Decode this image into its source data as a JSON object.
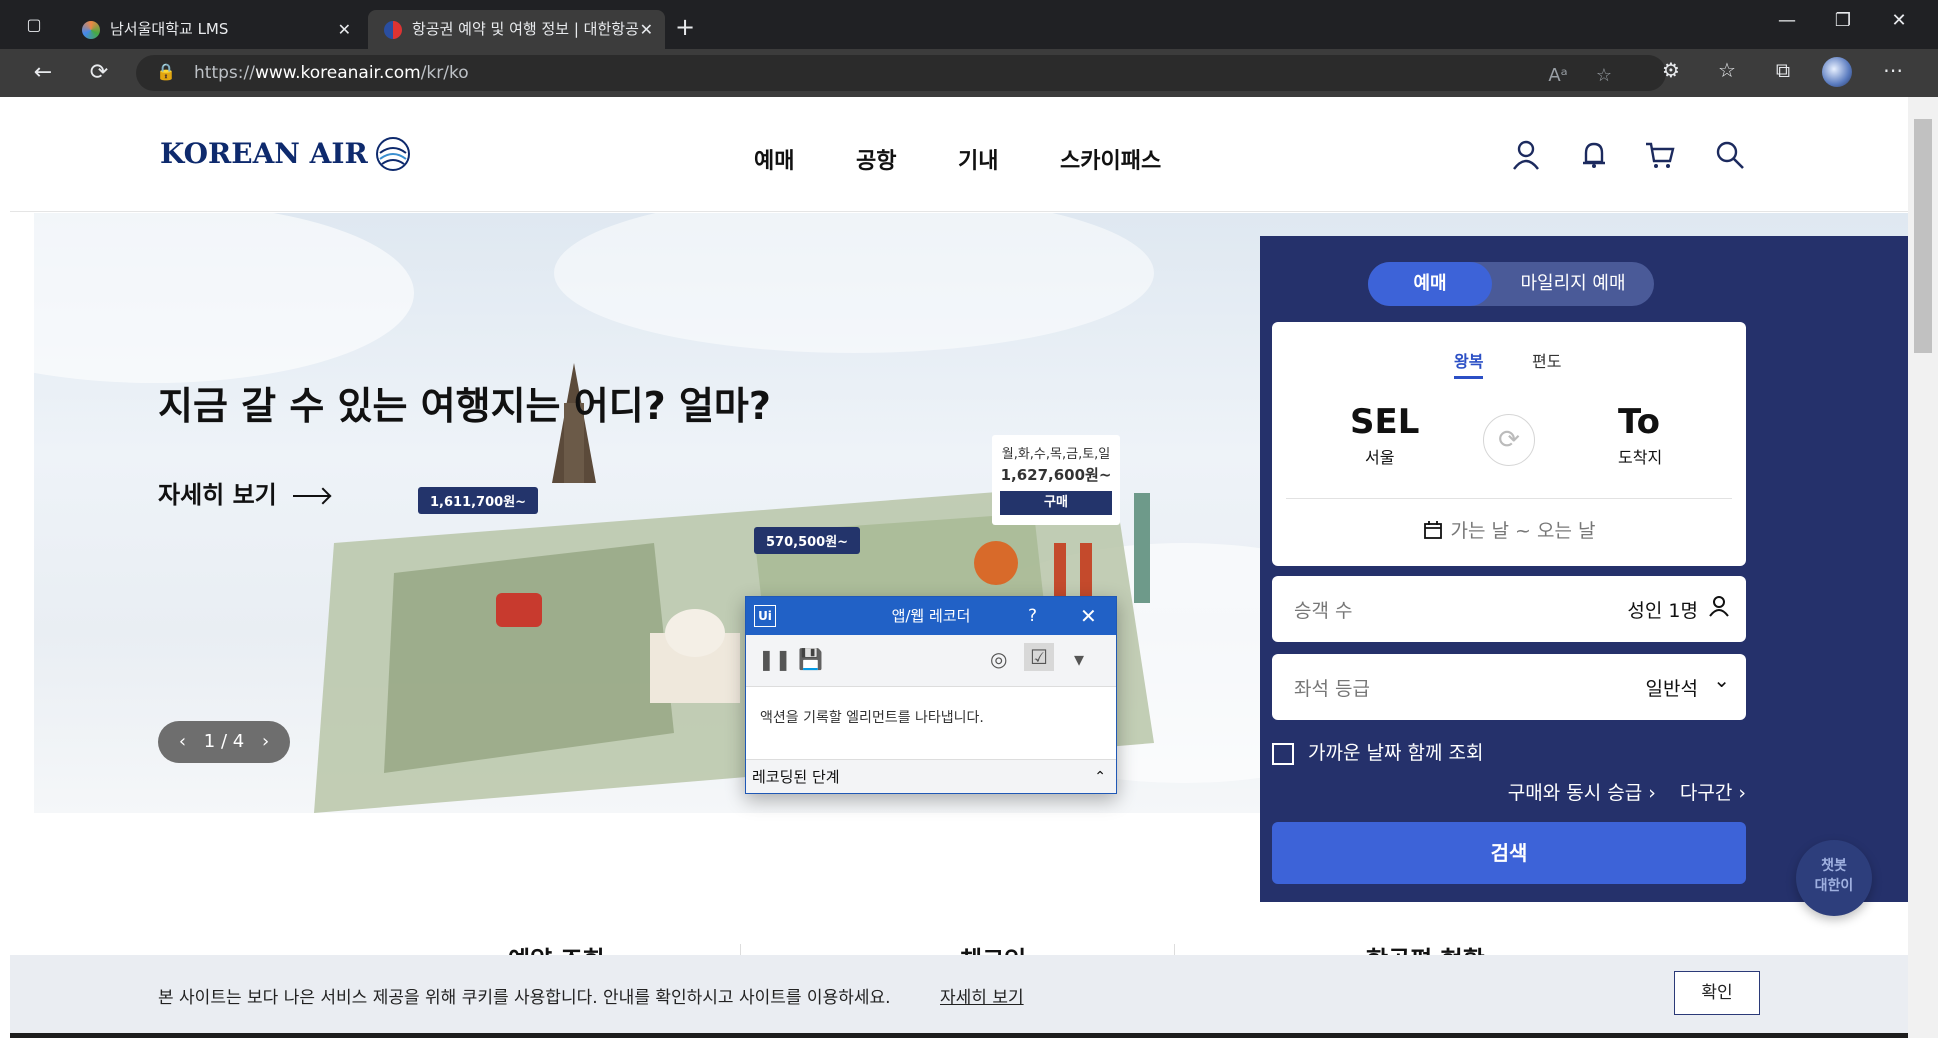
{
  "browser": {
    "tabs": [
      {
        "title": "남서울대학교 LMS",
        "active": false
      },
      {
        "title": "항공권 예약 및 여행 정보 | 대한항공",
        "active": true
      }
    ],
    "url_prefix": "https://",
    "url_host": "www.koreanair.com",
    "url_path": "/kr/ko",
    "glyphs": {
      "close": "✕",
      "new_tab": "+",
      "back": "←",
      "reload": "⟳",
      "lock": "🔒",
      "minimize": "—",
      "restore": "❐",
      "more": "⋯"
    }
  },
  "site": {
    "logo_text": "KOREAN AIR",
    "gnb": [
      "예매",
      "공항",
      "기내",
      "스카이패스"
    ]
  },
  "hero": {
    "title": "지금 갈 수 있는 여행지는 어디? 얼마?",
    "more_link": "자세히 보기",
    "pager": "1 / 4",
    "pager_prev": "‹",
    "pager_next": "›",
    "price_tags": [
      "1,611,700원~",
      "570,500원~"
    ],
    "promo": {
      "days": "월,화,수,목,금,토,일",
      "price": "1,627,600원~",
      "buy": "구매"
    }
  },
  "booking": {
    "mode_active": "예매",
    "mode_other": "마일리지 예매",
    "trip_round": "왕복",
    "trip_oneway": "편도",
    "from_code": "SEL",
    "from_city": "서울",
    "to_code": "To",
    "to_city": "도착지",
    "swap_glyph": "⟳",
    "date_placeholder": "가는 날 ~ 오는 날",
    "passenger_label": "승객 수",
    "passenger_value": "성인 1명",
    "seat_label": "좌석 등급",
    "seat_value": "일반석",
    "seat_chevron": "⌄",
    "nearby_dates": "가까운 날짜 함께 조회",
    "upgrade_link": "구매와 동시 승급 ›",
    "multi_link": "다구간 ›",
    "search": "검색"
  },
  "chatbot": {
    "line1": "챗봇",
    "line2": "대한이"
  },
  "quick_links": [
    "예약 조회",
    "체크인",
    "항공편 현황"
  ],
  "cookie": {
    "text": "본 사이트는 보다 나은 서비스 제공을 위해 쿠키를 사용합니다. 안내를 확인하시고 사이트를 이용하세요.",
    "more": "자세히 보기",
    "ok": "확인"
  },
  "recorder": {
    "icon": "Ui",
    "title": "앱/웹 레코더",
    "help": "?",
    "close": "✕",
    "tools": {
      "pause": "❚❚",
      "save": "💾",
      "target": "◎",
      "list": "☑",
      "more": "▾"
    },
    "message": "액션을 기록할 엘리먼트를 나타냅니다.",
    "footer": "레코딩된 단계",
    "footer_toggle": "⌃"
  },
  "colors": {
    "brand_navy": "#25316b",
    "accent_blue": "#3d63d8",
    "recorder_blue": "#2161c6"
  }
}
